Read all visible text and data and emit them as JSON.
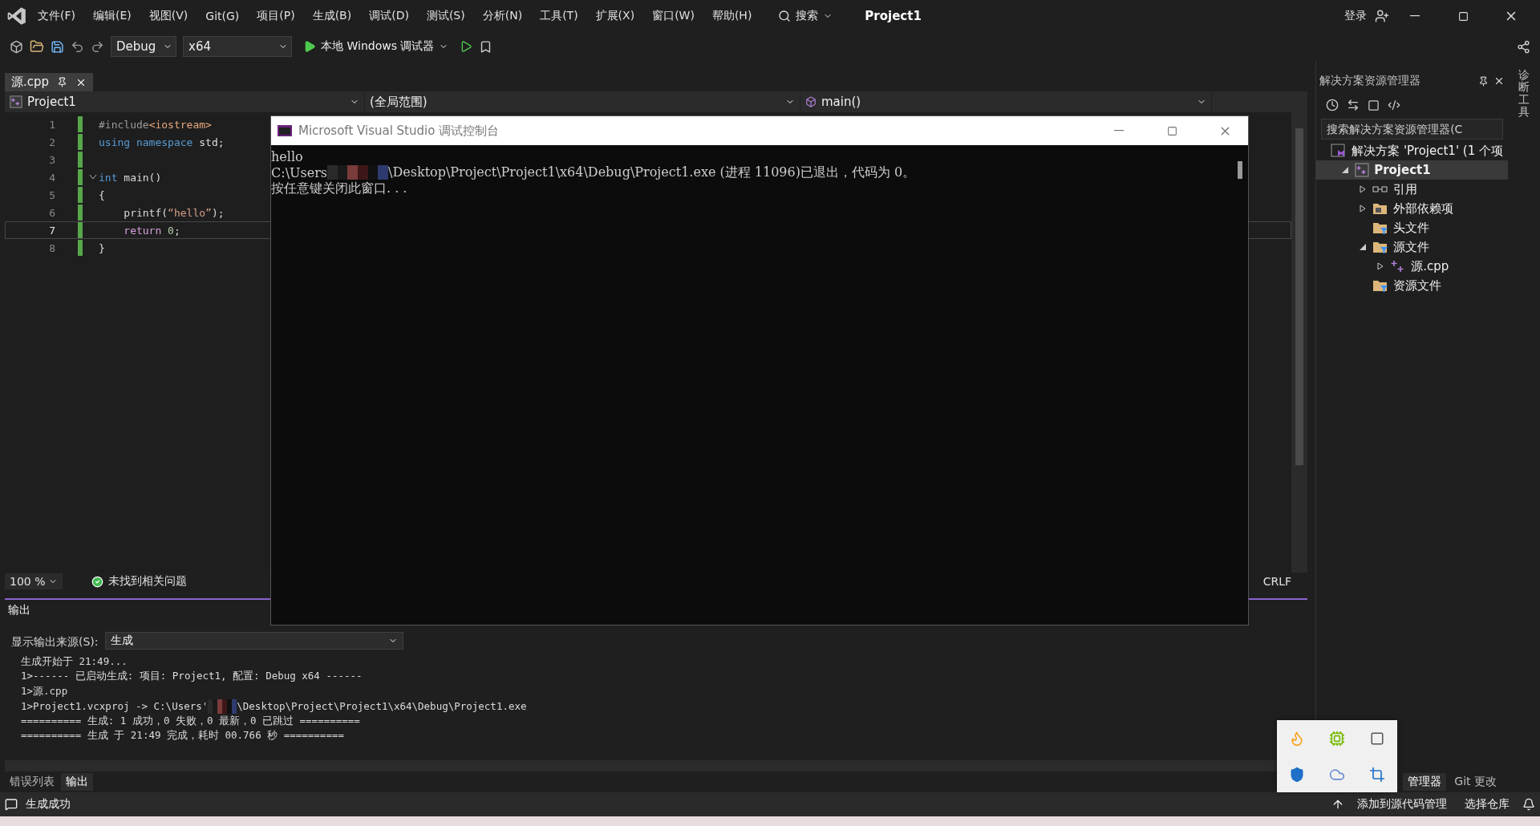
{
  "menu_bar": {
    "items": [
      "文件(F)",
      "编辑(E)",
      "视图(V)",
      "Git(G)",
      "项目(P)",
      "生成(B)",
      "调试(D)",
      "测试(S)",
      "分析(N)",
      "工具(T)",
      "扩展(X)",
      "窗口(W)",
      "帮助(H)"
    ],
    "search": "搜索",
    "title": "Project1",
    "sign_in": "登录"
  },
  "toolbar": {
    "configuration": "Debug",
    "platform": "x64",
    "debugger": "本地 Windows 调试器"
  },
  "editor": {
    "tab": "源.cpp",
    "project": "Project1",
    "scope": "(全局范围)",
    "member": "main()",
    "lines": [
      {
        "number": "1",
        "current": false,
        "fold": false,
        "tokens": [
          {
            "kind": "directive",
            "text": "#include"
          },
          {
            "kind": "header",
            "text": "<iostream>"
          }
        ]
      },
      {
        "number": "2",
        "current": false,
        "fold": false,
        "tokens": [
          {
            "kind": "keyword",
            "text": "using "
          },
          {
            "kind": "keyword",
            "text": "namespace "
          },
          {
            "kind": "plain",
            "text": "std;"
          }
        ]
      },
      {
        "number": "3",
        "current": false,
        "fold": false
      },
      {
        "number": "4",
        "current": false,
        "fold": true,
        "tokens": [
          {
            "kind": "keyword",
            "text": "int "
          },
          {
            "kind": "plain",
            "text": "main()"
          }
        ]
      },
      {
        "number": "5",
        "current": false,
        "fold": false,
        "tokens": [
          {
            "kind": "plain",
            "text": "{"
          }
        ]
      },
      {
        "number": "6",
        "current": false,
        "fold": false,
        "tokens": [
          {
            "kind": "plain",
            "text": "    printf("
          },
          {
            "kind": "string",
            "text": "“hello”"
          },
          {
            "kind": "plain",
            "text": ");"
          }
        ]
      },
      {
        "number": "7",
        "current": true,
        "fold": false,
        "tokens": [
          {
            "kind": "control",
            "text": "    return "
          },
          {
            "kind": "number",
            "text": "0"
          },
          {
            "kind": "plain",
            "text": ";"
          }
        ]
      },
      {
        "number": "8",
        "current": false,
        "fold": false,
        "tokens": [
          {
            "kind": "plain",
            "text": "}"
          }
        ]
      }
    ],
    "zoom": "100 %",
    "issues": "未找到相关问题",
    "line_ending": "CRLF"
  },
  "output": {
    "title": "输出",
    "source_label": "显示输出来源(S):",
    "source": "生成",
    "lines": [
      {
        "kind": "text",
        "text": "生成开始于 21:49..."
      },
      {
        "kind": "text",
        "text": "1>------ 已启动生成: 项目: Project1, 配置: Debug x64 ------"
      },
      {
        "kind": "text",
        "text": "1>源.cpp"
      },
      {
        "kind": "redacted",
        "before": "1>Project1.vcxproj -> C:\\Users'",
        "after": "\\Desktop\\Project\\Project1\\x64\\Debug\\Project1.exe"
      },
      {
        "kind": "text",
        "text": "========== 生成: 1 成功，0 失败，0 最新，0 已跳过 =========="
      },
      {
        "kind": "text",
        "text": "========== 生成 于 21:49 完成，耗时 00.766 秒 =========="
      }
    ]
  },
  "bottom_tabs": [
    {
      "label": "错误列表",
      "selected": false
    },
    {
      "label": "输出",
      "selected": true
    }
  ],
  "console": {
    "title": "Microsoft Visual Studio 调试控制台",
    "lines": [
      {
        "kind": "text",
        "text": "hello"
      },
      {
        "kind": "redacted",
        "before": "C:\\Users",
        "after": "\\Desktop\\Project\\Project1\\x64\\Debug\\Project1.exe (进程 11096)已退出，代码为 0。"
      },
      {
        "kind": "text",
        "text": "按任意键关闭此窗口. . ."
      }
    ]
  },
  "solution_explorer": {
    "title": "解决方案资源管理器",
    "search_placeholder": "搜索解决方案资源管理器(C",
    "tree": [
      {
        "label": "解决方案 'Project1' (1 个项",
        "kind": "solution",
        "children": [
          {
            "label": "Project1",
            "kind": "project",
            "expanded": true,
            "selected": true,
            "children": [
              {
                "label": "引用",
                "kind": "references",
                "expanded": false,
                "selected": false
              },
              {
                "label": "外部依赖项",
                "kind": "folder",
                "expanded": false,
                "selected": false
              },
              {
                "label": "头文件",
                "kind": "filter",
                "selected": false
              },
              {
                "label": "源文件",
                "kind": "filter",
                "expanded": true,
                "selected": false,
                "children": [
                  {
                    "label": "源.cpp",
                    "kind": "cpp",
                    "expanded": false,
                    "selected": false
                  }
                ]
              },
              {
                "label": "资源文件",
                "kind": "filter",
                "selected": false
              }
            ]
          }
        ]
      }
    ],
    "bottom_tabs": [
      {
        "label": "管理器",
        "selected": true
      },
      {
        "label": "Git 更改",
        "selected": false
      }
    ]
  },
  "side_tab": "诊断工具",
  "status_bar": {
    "message": "生成成功",
    "source_control": "添加到源代码管理",
    "repository": "选择仓库"
  }
}
